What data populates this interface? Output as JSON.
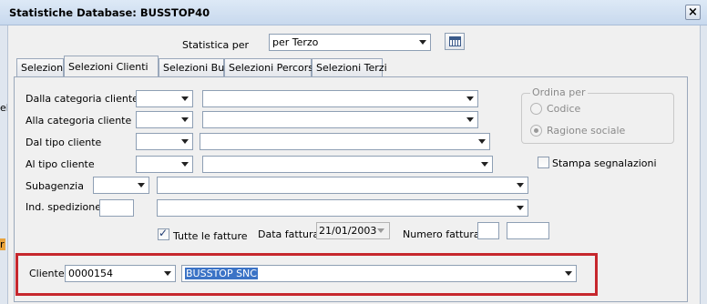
{
  "window": {
    "title": "Statistiche Database: BUSSTOP40",
    "close_glyph": "×"
  },
  "background_fragments": {
    "top": "el",
    "bottom": "r"
  },
  "statistica": {
    "label": "Statistica per",
    "value": "per Terzo"
  },
  "tabs": [
    {
      "label": "Selezioni"
    },
    {
      "label": "Selezioni Clienti"
    },
    {
      "label": "Selezioni Bus"
    },
    {
      "label": "Selezioni Percorsi"
    },
    {
      "label": "Selezioni Terzi"
    }
  ],
  "fields": {
    "dalla_categoria": {
      "label": "Dalla categoria cliente",
      "code": "",
      "desc": ""
    },
    "alla_categoria": {
      "label": "Alla categoria cliente",
      "code": "",
      "desc": ""
    },
    "dal_tipo": {
      "label": "Dal tipo cliente",
      "code": "",
      "desc": ""
    },
    "al_tipo": {
      "label": "Al tipo cliente",
      "code": "",
      "desc": ""
    },
    "subagenzia": {
      "label": "Subagenzia",
      "code": "",
      "desc": ""
    },
    "ind_spedizione": {
      "label": "Ind. spedizione",
      "code": "",
      "desc": ""
    }
  },
  "ordina": {
    "title": "Ordina per",
    "option_codice": "Codice",
    "option_ragione": "Ragione sociale",
    "selected": "Ragione sociale"
  },
  "stampa_segnalazioni": {
    "label": "Stampa segnalazioni",
    "checked": false
  },
  "tutte_fatture": {
    "label": "Tutte le fatture",
    "checked": true
  },
  "data_fattura": {
    "label": "Data fattura",
    "value": "21/01/2003"
  },
  "numero_fattura": {
    "label": "Numero fattura",
    "from": "",
    "to": ""
  },
  "cliente": {
    "label": "Cliente",
    "code": "0000154",
    "name": "BUSSTOP SNC"
  },
  "colors": {
    "highlight": "#c6272d",
    "selection": "#3b73c6"
  }
}
